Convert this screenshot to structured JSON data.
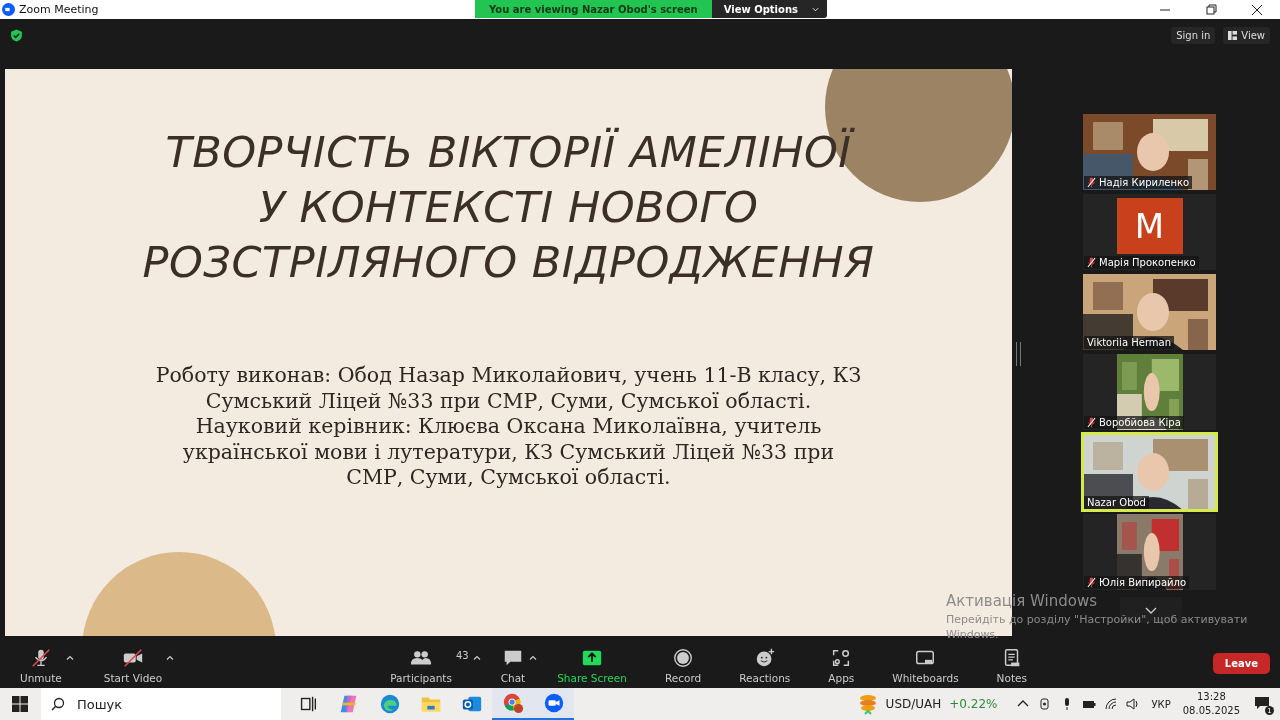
{
  "window": {
    "title": "Zoom Meeting"
  },
  "share_banner": {
    "text": "You are viewing Nazar Obod's screen",
    "options": "View Options"
  },
  "header": {
    "sign_in": "Sign in",
    "view": "View"
  },
  "slide": {
    "title_lines": [
      "ТВОРЧІСТЬ ВІКТОРІЇ АМЕЛІНОЇ",
      "У КОНТЕКСТІ НОВОГО",
      "РОЗСТРІЛЯНОГО ВІДРОДЖЕННЯ"
    ],
    "body_lines": [
      "Роботу виконав: Обод Назар Миколайович, учень 11-В класу, КЗ",
      "Сумський Ліцей №33 при СМР, Суми, Сумської області.",
      "Науковий керівник: Клюєва Оксана Миколаївна, учитель",
      "української мови і лутератури, КЗ Сумський Ліцей №33 при",
      "СМР, Суми, Сумської області."
    ]
  },
  "participants": [
    {
      "name": "Надія Кириленко",
      "muted": true,
      "kind": "video",
      "speaking": false
    },
    {
      "name": "Марія Прокопенко",
      "muted": true,
      "kind": "avatar",
      "initial": "M",
      "speaking": false
    },
    {
      "name": "Viktoriia Herman",
      "muted": false,
      "kind": "video",
      "speaking": false
    },
    {
      "name": "Воробйова Кіра",
      "muted": true,
      "kind": "portrait",
      "speaking": false
    },
    {
      "name": "Nazar Obod",
      "muted": false,
      "kind": "video",
      "speaking": true
    },
    {
      "name": "Юлія Випирайло",
      "muted": true,
      "kind": "portrait",
      "speaking": false
    }
  ],
  "activation": {
    "title": "Активація Windows",
    "text": "Перейдіть до розділу \"Настройки\", щоб активувати Windows."
  },
  "toolbar": {
    "left": [
      {
        "kind": "mic",
        "label": "Unmute",
        "off": true
      },
      {
        "kind": "video",
        "label": "Start Video",
        "off": true
      }
    ],
    "center": [
      {
        "kind": "participants",
        "label": "Participants",
        "count": "43",
        "caret": true
      },
      {
        "kind": "chat",
        "label": "Chat",
        "caret": true
      },
      {
        "kind": "share",
        "label": "Share Screen",
        "caret": false
      },
      {
        "kind": "record",
        "label": "Record",
        "caret": false
      },
      {
        "kind": "reactions",
        "label": "Reactions",
        "caret": false
      },
      {
        "kind": "apps",
        "label": "Apps",
        "caret": false
      },
      {
        "kind": "whiteboards",
        "label": "Whiteboards",
        "caret": false
      },
      {
        "kind": "notes",
        "label": "Notes",
        "caret": false
      }
    ],
    "leave": "Leave"
  },
  "taskbar": {
    "search_placeholder": "Пошук",
    "apps": [
      {
        "kind": "taskview",
        "running": false
      },
      {
        "kind": "copilot",
        "running": false
      },
      {
        "kind": "edge",
        "running": false
      },
      {
        "kind": "explorer",
        "running": false
      },
      {
        "kind": "outlook",
        "running": false
      },
      {
        "kind": "chrome",
        "running": true
      },
      {
        "kind": "zoom",
        "running": true
      }
    ],
    "ticker": "USD/UAH",
    "change": "+0.22%",
    "language": "УКР",
    "time": "13:28",
    "date": "08.05.2025",
    "notifications": "1"
  }
}
